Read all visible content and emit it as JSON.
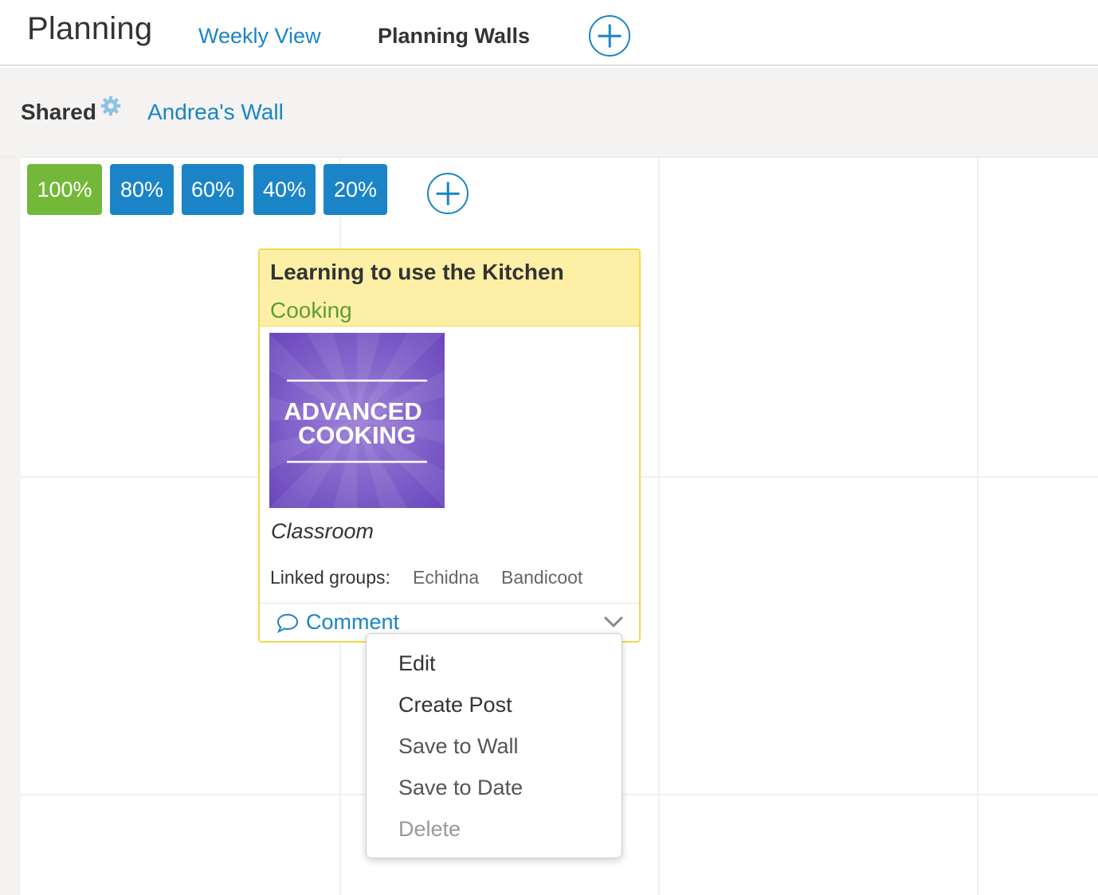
{
  "header": {
    "app_title": "Planning",
    "nav": [
      {
        "label": "Weekly View"
      },
      {
        "label": "Planning Walls"
      }
    ],
    "add_icon": "plus-circle-icon"
  },
  "subbar": {
    "shared_label": "Shared",
    "settings_icon": "gear-icon",
    "wall_name": "Andrea's Wall"
  },
  "percent_buttons": [
    {
      "label": "100%",
      "active": true
    },
    {
      "label": "80%",
      "active": false
    },
    {
      "label": "60%",
      "active": false
    },
    {
      "label": "40%",
      "active": false
    },
    {
      "label": "20%",
      "active": false
    }
  ],
  "card": {
    "title": "Learning to use the Kitchen",
    "subject": "Cooking",
    "thumbnail": {
      "line1": "ADVANCED",
      "line2": "COOKING"
    },
    "location": "Classroom",
    "linked_groups_label": "Linked groups:",
    "linked_groups": [
      "Echidna",
      "Bandicoot"
    ],
    "comment_label": "Comment",
    "comment_icon": "speech-bubble-icon",
    "menu_icon": "chevron-down-icon"
  },
  "menu": {
    "items": [
      {
        "label": "Edit"
      },
      {
        "label": "Create Post"
      },
      {
        "label": "Save to Wall"
      },
      {
        "label": "Save to Date"
      },
      {
        "label": "Delete"
      }
    ]
  },
  "colors": {
    "accent_blue": "#1a84c7",
    "active_green": "#74b83a",
    "card_header": "#fdf0a6",
    "card_border": "#f4d94f",
    "subject_green": "#5e9e2f",
    "thumbnail_purple": "#7b5cc4"
  }
}
